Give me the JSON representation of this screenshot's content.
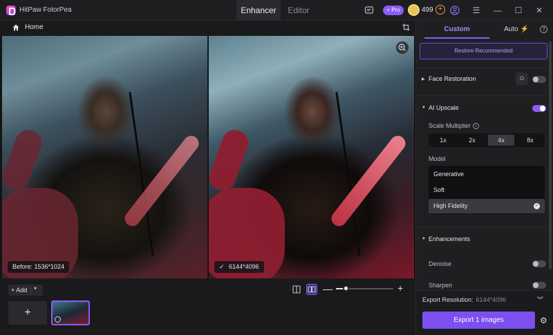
{
  "app": {
    "name": "HitPaw FotorPea"
  },
  "top_tabs": {
    "enhancer": "Enhancer",
    "editor": "Editor"
  },
  "account": {
    "pro_label": "+ Pro",
    "credits": "499",
    "add_symbol": "+"
  },
  "window_controls": {
    "menu": "☰",
    "minimize": "—",
    "maximize": "☐",
    "close": "✕"
  },
  "home": {
    "label": "Home"
  },
  "preview": {
    "before_label": "Before: 1536*1024",
    "after_label": "6144*4096",
    "after_check": "✓"
  },
  "bottom": {
    "add_label": "+ Add",
    "add_tile_symbol": "+",
    "zoom_minus": "—",
    "zoom_plus": "+",
    "zoom_level": 0.17
  },
  "panel": {
    "tabs": {
      "custom": "Custom",
      "auto": "Auto ⚡"
    },
    "help": "?",
    "restore_label": "Restore Recommended",
    "face_restoration": {
      "title": "Face Restoration",
      "enabled": false
    },
    "ai_upscale": {
      "title": "AI Upscale",
      "enabled": true,
      "scale_label": "Scale Multiplier",
      "scales": [
        "1x",
        "2x",
        "4x",
        "8x"
      ],
      "selected_scale": "4x",
      "model_label": "Model",
      "models": [
        "Generative",
        "Soft",
        "High Fidelity"
      ],
      "selected_model": "High Fidelity"
    },
    "enhancements": {
      "title": "Enhancements",
      "denoise": {
        "label": "Denoise",
        "enabled": false
      },
      "sharpen": {
        "label": "Sharpen",
        "enabled": false
      }
    },
    "export": {
      "resolution_label": "Export Resolution:",
      "resolution_value": "6144*4096",
      "button_label": "Export 1 images"
    }
  },
  "colors": {
    "accent": "#8b5cf6",
    "export_button": "#7b4ff0",
    "credit_coin": "#e6c35a"
  },
  "icons": [
    "app-logo-icon",
    "chat-icon",
    "pro-badge",
    "coin-icon",
    "add-credit-icon",
    "user-icon",
    "menu-icon",
    "minimize-icon",
    "maximize-icon",
    "close-icon",
    "home-icon",
    "crop-icon",
    "zoom-in-icon",
    "compare-single-icon",
    "compare-split-icon",
    "face-icon",
    "info-icon",
    "check-icon",
    "expand-icon",
    "gear-icon"
  ]
}
